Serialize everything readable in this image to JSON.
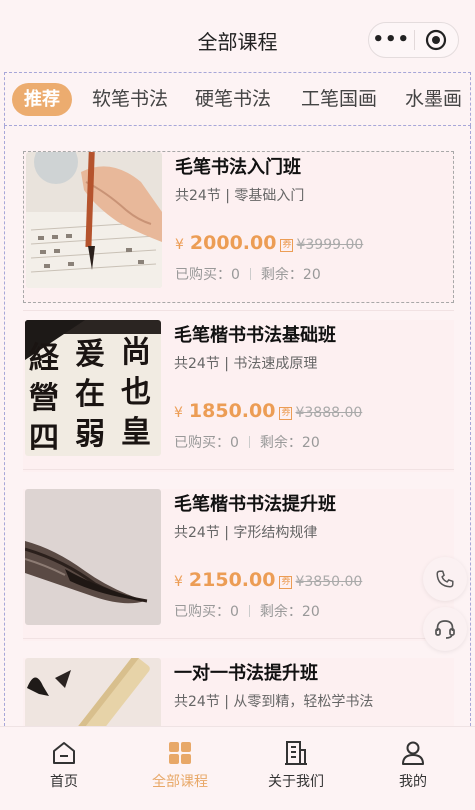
{
  "header": {
    "title": "全部课程",
    "more_icon": "•••"
  },
  "categories": [
    {
      "label": "推荐",
      "active": true
    },
    {
      "label": "软笔书法"
    },
    {
      "label": "硬笔书法"
    },
    {
      "label": "工笔国画"
    },
    {
      "label": "水墨画"
    }
  ],
  "courses": [
    {
      "title": "毛笔书法入门班",
      "subtitle": "共24节 | 零基础入门",
      "currency": "¥",
      "price": "2000.00",
      "tag": "券",
      "original_price": "¥3999.00",
      "bought": "已购买：0",
      "remaining": "剩余：20",
      "image_icon": "brush-painting-image"
    },
    {
      "title": "毛笔楷书书法基础班",
      "subtitle": "共24节 | 书法速成原理",
      "currency": "¥",
      "price": "1850.00",
      "tag": "券",
      "original_price": "¥3888.00",
      "bought": "已购买：0",
      "remaining": "剩余：20",
      "image_icon": "calligraphy-characters-image",
      "image_chars": [
        "経",
        "爰",
        "尚",
        "營",
        "在",
        "也",
        "四",
        "弱",
        "皇"
      ]
    },
    {
      "title": "毛笔楷书书法提升班",
      "subtitle": "共24节 | 字形结构规律",
      "currency": "¥",
      "price": "2150.00",
      "tag": "券",
      "original_price": "¥3850.00",
      "bought": "已购买：0",
      "remaining": "剩余：20",
      "image_icon": "brush-tip-image"
    },
    {
      "title": "一对一书法提升班",
      "subtitle": "共24节 | 从零到精，轻松学书法",
      "image_icon": "brush-stroke-image"
    }
  ],
  "floating": {
    "phone_icon": "phone-icon",
    "service_icon": "headset-icon"
  },
  "tabbar": [
    {
      "label": "首页",
      "icon": "home-icon"
    },
    {
      "label": "全部课程",
      "icon": "grid-icon",
      "active": true
    },
    {
      "label": "关于我们",
      "icon": "building-icon"
    },
    {
      "label": "我的",
      "icon": "user-icon"
    }
  ],
  "colors": {
    "accent": "#ecac6f",
    "price": "#ec9d55",
    "background": "#fdf3f4"
  }
}
